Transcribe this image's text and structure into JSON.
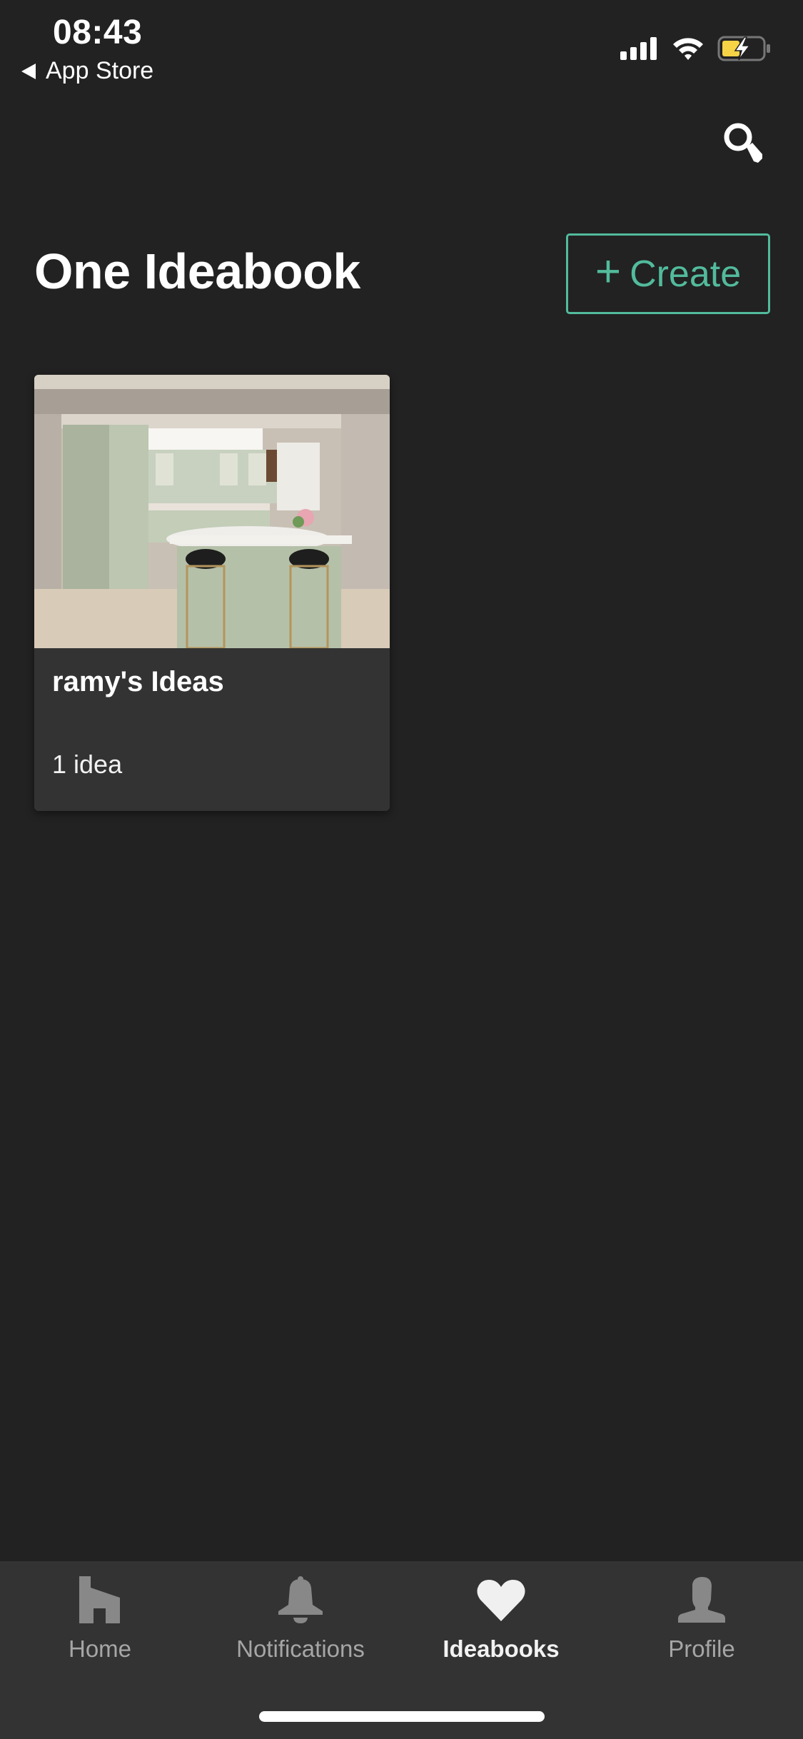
{
  "status_bar": {
    "time": "08:43",
    "back_label": "App Store",
    "icons": [
      "cellular-signal-icon",
      "wifi-icon",
      "battery-charging-icon"
    ],
    "battery_color": "#f6d445"
  },
  "header": {
    "search_icon": "search-icon",
    "title": "One Ideabook",
    "create_button": {
      "icon": "+",
      "label": "Create"
    },
    "accent_color": "#52bb9c"
  },
  "ideabooks": [
    {
      "title": "ramy's Ideas",
      "count_label": "1 idea",
      "image_alt": "Sage green kitchen with curved island and black stools"
    }
  ],
  "tabbar": {
    "tabs": [
      {
        "label": "Home",
        "icon": "home-icon",
        "active": false
      },
      {
        "label": "Notifications",
        "icon": "bell-icon",
        "active": false
      },
      {
        "label": "Ideabooks",
        "icon": "heart-icon",
        "active": true
      },
      {
        "label": "Profile",
        "icon": "profile-icon",
        "active": false
      }
    ]
  }
}
